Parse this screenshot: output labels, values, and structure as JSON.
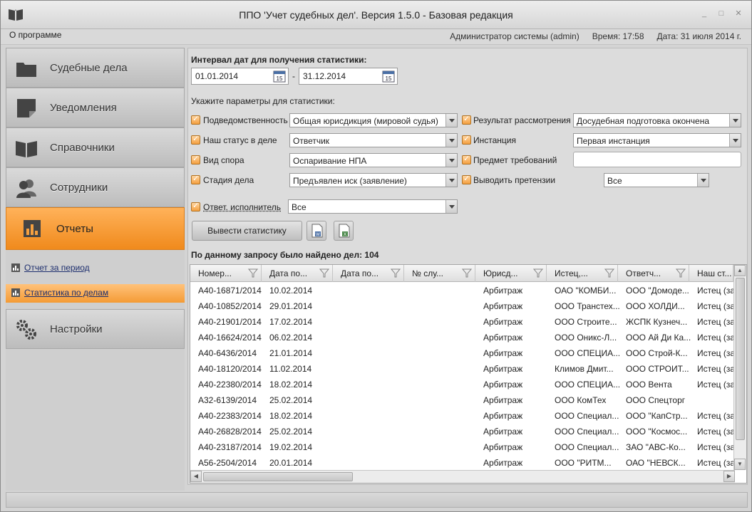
{
  "window": {
    "title": "ППО 'Учет судебных дел'. Версия 1.5.0 - Базовая редакция",
    "minimize": "_",
    "maximize": "□",
    "close": "✕"
  },
  "menu": {
    "about": "О программе",
    "user": "Администратор системы (admin)",
    "time": "Время: 17:58",
    "date": "Дата: 31 июля 2014 г."
  },
  "sidebar": {
    "items": [
      {
        "label": "Судебные дела",
        "icon": "folder-icon"
      },
      {
        "label": "Уведомления",
        "icon": "note-icon"
      },
      {
        "label": "Справочники",
        "icon": "book-icon"
      },
      {
        "label": "Сотрудники",
        "icon": "users-icon"
      },
      {
        "label": "Отчеты",
        "icon": "chart-icon"
      },
      {
        "label": "Настройки",
        "icon": "gears-icon"
      }
    ],
    "sub_items": [
      {
        "label": "Отчет за период"
      },
      {
        "label": "Статистика по делам"
      }
    ]
  },
  "stats": {
    "interval_label": "Интервал дат для получения статистики:",
    "date_from": "01.01.2014",
    "date_to": "31.12.2014",
    "date_sep": "-",
    "cal_day": "15",
    "params_label": "Укажите параметры для статистики:",
    "params": {
      "jurisdiction_label": "Подведомственность",
      "jurisdiction_value": "Общая юрисдикция (мировой судья)",
      "result_label": "Результат рассмотрения",
      "result_value": "Досудебная подготовка окончена",
      "status_label": "Наш статус в деле",
      "status_value": "Ответчик",
      "instance_label": "Инстанция",
      "instance_value": "Первая инстанция",
      "dispute_label": "Вид спора",
      "dispute_value": "Оспаривание НПА",
      "subject_label": "Предмет требований",
      "subject_value": "",
      "stage_label": "Стадия дела",
      "stage_value": "Предъявлен иск (заявление)",
      "claims_label": "Выводить претензии",
      "claims_value": "Все",
      "executor_label": "Ответ. исполнитель",
      "executor_value": "Все"
    },
    "show_button": "Вывести статистику",
    "found_text": "По данному запросу было найдено дел: 104"
  },
  "grid": {
    "columns": [
      "Номер...",
      "Дата по...",
      "Дата по...",
      "№ слу...",
      "Юрисд...",
      "Истец,...",
      "Ответч...",
      "Наш ст..."
    ],
    "rows": [
      [
        "А40-16871/2014",
        "10.02.2014",
        "",
        "",
        "Арбитраж",
        "ОАО \"КОМБИ...",
        "ООО \"Домоде...",
        "Истец (за"
      ],
      [
        "А40-10852/2014",
        "29.01.2014",
        "",
        "",
        "Арбитраж",
        "ООО Транстех...",
        "ООО ХОЛДИ...",
        "Истец (за"
      ],
      [
        "А40-21901/2014",
        "17.02.2014",
        "",
        "",
        "Арбитраж",
        "ООО Строите...",
        "ЖСПК Кузнеч...",
        "Истец (за"
      ],
      [
        "А40-16624/2014",
        "06.02.2014",
        "",
        "",
        "Арбитраж",
        "ООО Оникс-Л...",
        "ООО Ай Ди Ка...",
        "Истец (за"
      ],
      [
        "А40-6436/2014",
        "21.01.2014",
        "",
        "",
        "Арбитраж",
        "ООО СПЕЦИА...",
        "ООО Строй-К...",
        "Истец (за"
      ],
      [
        "А40-18120/2014",
        "11.02.2014",
        "",
        "",
        "Арбитраж",
        "Климов Дмит...",
        "ООО СТРОИТ...",
        "Истец (за"
      ],
      [
        "А40-22380/2014",
        "18.02.2014",
        "",
        "",
        "Арбитраж",
        "ООО СПЕЦИА...",
        "ООО Вента",
        "Истец (за"
      ],
      [
        "А32-6139/2014",
        "25.02.2014",
        "",
        "",
        "Арбитраж",
        "ООО КомТех",
        "ООО Спецторг",
        ""
      ],
      [
        "А40-22383/2014",
        "18.02.2014",
        "",
        "",
        "Арбитраж",
        "ООО Специал...",
        "ООО \"КапСтр...",
        "Истец (за"
      ],
      [
        "А40-26828/2014",
        "25.02.2014",
        "",
        "",
        "Арбитраж",
        "ООО Специал...",
        "ООО \"Космос...",
        "Истец (за"
      ],
      [
        "А40-23187/2014",
        "19.02.2014",
        "",
        "",
        "Арбитраж",
        "ООО Специал...",
        "ЗАО \"АВС-Ко...",
        "Истец (за"
      ],
      [
        "А56-2504/2014",
        "20.01.2014",
        "",
        "",
        "Арбитраж",
        "ООО \"РИТМ...",
        "ОАО \"НЕВСК...",
        "Истец (за"
      ]
    ]
  },
  "colors": {
    "accent": "#f5962a",
    "link": "#1e2f6e"
  }
}
